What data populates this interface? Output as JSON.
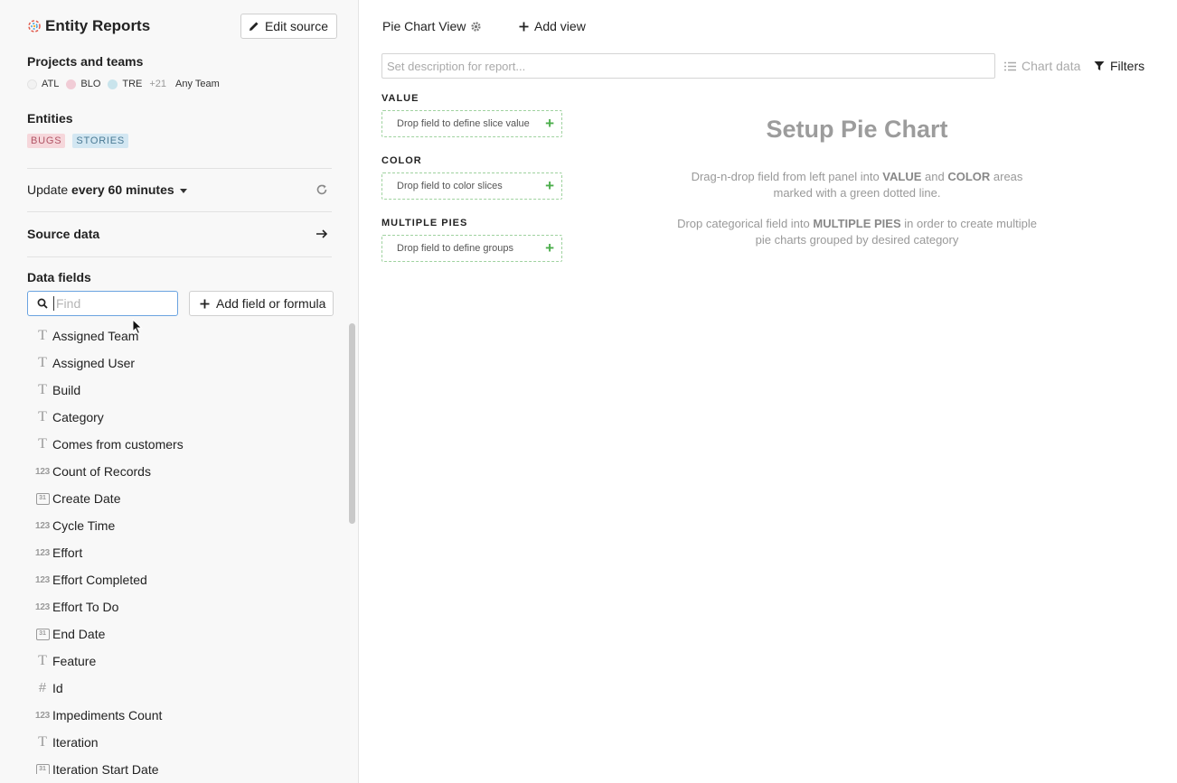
{
  "app": {
    "title": "Entity Reports",
    "edit_label": "Edit source"
  },
  "projects": {
    "heading": "Projects and teams",
    "items": [
      {
        "label": "ATL",
        "color": "#f2f2f2"
      },
      {
        "label": "BLO",
        "color": "#f1ccd6"
      },
      {
        "label": "TRE",
        "color": "#c9e4ec"
      }
    ],
    "more": "+21",
    "team": "Any Team"
  },
  "entities": {
    "heading": "Entities",
    "tags": [
      "BUGS",
      "STORIES"
    ]
  },
  "update": {
    "prefix": "Update ",
    "value": "every 60 minutes"
  },
  "source": {
    "label": "Source data"
  },
  "data_fields": {
    "heading": "Data fields",
    "search_placeholder": "Find",
    "add_label": "Add field or formula",
    "items": [
      {
        "icon": "text",
        "name": "Assigned Team"
      },
      {
        "icon": "text",
        "name": "Assigned User"
      },
      {
        "icon": "text",
        "name": "Build"
      },
      {
        "icon": "text",
        "name": "Category"
      },
      {
        "icon": "text",
        "name": "Comes from customers"
      },
      {
        "icon": "number",
        "name": "Count of Records"
      },
      {
        "icon": "date",
        "name": "Create Date"
      },
      {
        "icon": "number",
        "name": "Cycle Time"
      },
      {
        "icon": "number",
        "name": "Effort"
      },
      {
        "icon": "number",
        "name": "Effort Completed"
      },
      {
        "icon": "number",
        "name": "Effort To Do"
      },
      {
        "icon": "date",
        "name": "End Date"
      },
      {
        "icon": "text",
        "name": "Feature"
      },
      {
        "icon": "hash",
        "name": "Id"
      },
      {
        "icon": "number",
        "name": "Impediments Count"
      },
      {
        "icon": "text",
        "name": "Iteration"
      },
      {
        "icon": "date",
        "name": "Iteration Start Date"
      }
    ]
  },
  "view": {
    "tab_label": "Pie Chart View",
    "add_view_label": "Add view",
    "description_placeholder": "Set description for report...",
    "chart_data_label": "Chart data",
    "filters_label": "Filters"
  },
  "drops": {
    "value_label": "VALUE",
    "value_hint": "Drop field to define slice value",
    "color_label": "COLOR",
    "color_hint": "Drop field to color slices",
    "multi_label": "MULTIPLE PIES",
    "multi_hint": "Drop field to define groups"
  },
  "setup": {
    "title": "Setup Pie Chart",
    "p1_a": "Drag-n-drop field from left panel into ",
    "p1_b": "VALUE",
    "p1_c": " and ",
    "p1_d": "COLOR",
    "p1_e": " areas marked with a green dotted line.",
    "p2_a": "Drop categorical field into ",
    "p2_b": "MULTIPLE PIES",
    "p2_c": " in order to create multiple pie charts grouped by desired category"
  },
  "icons": {
    "type_text": "T",
    "type_number": "123",
    "type_date": "31",
    "type_hash": "#"
  }
}
